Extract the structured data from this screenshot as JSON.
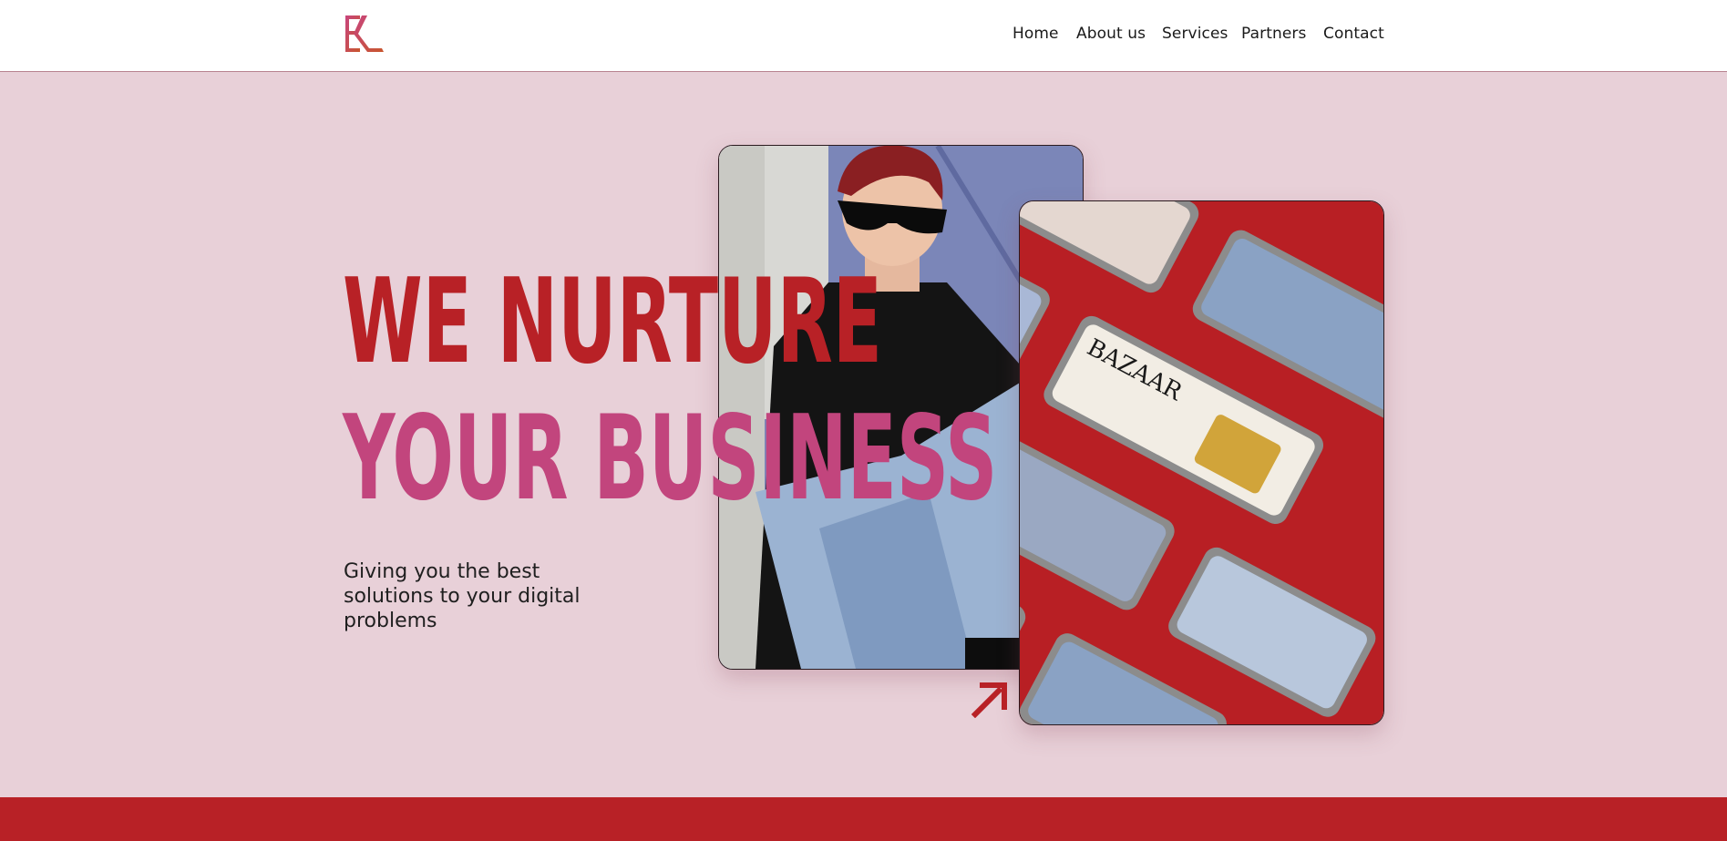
{
  "header": {
    "logo_name": "ek-monogram-logo",
    "nav": [
      {
        "label": "Home"
      },
      {
        "label": "About us"
      },
      {
        "label": "Services"
      },
      {
        "label": "Partners"
      },
      {
        "label": "Contact"
      }
    ]
  },
  "hero": {
    "headline_line1": "WE NURTURE",
    "headline_line2": "YOUR BUSINESS",
    "subtitle": "Giving you the best solutions to your digital problems",
    "phone_magazine_text": "BAZAAR"
  },
  "colors": {
    "background": "#e8d0d8",
    "accent_red": "#b82126",
    "accent_pink": "#c2457d",
    "header_bg": "#ffffff"
  },
  "icons": {
    "arrow": "arrow-up-right-icon"
  }
}
